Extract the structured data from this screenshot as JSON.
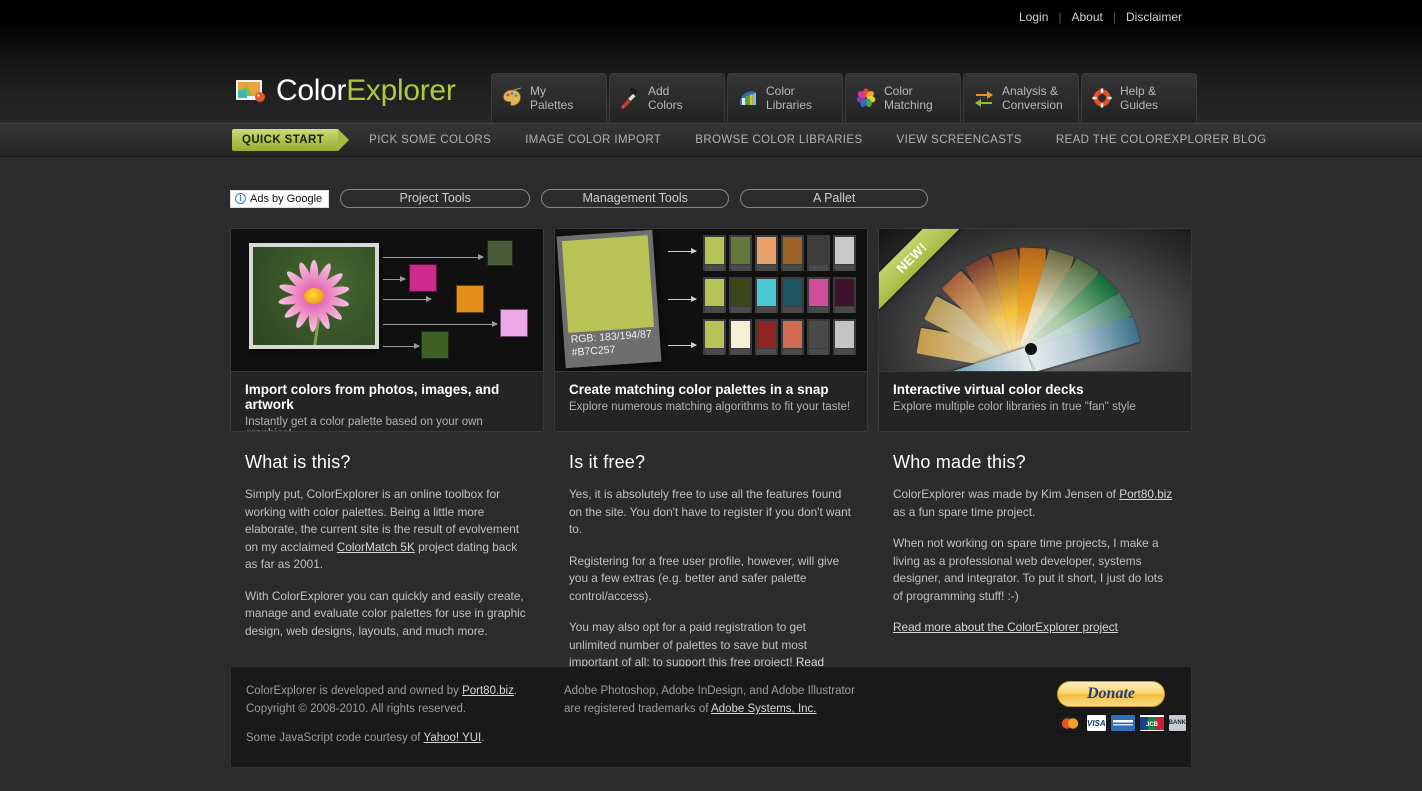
{
  "brand": {
    "name_part1": "Color",
    "name_part2": "Explorer",
    "logo_icon": "picture-palette-icon"
  },
  "utility_nav": [
    {
      "label": "Login"
    },
    {
      "label": "About"
    },
    {
      "label": "Disclaimer"
    }
  ],
  "main_nav": [
    {
      "line1": "My",
      "line2": "Palettes",
      "icon": "palette-icon"
    },
    {
      "line1": "Add",
      "line2": "Colors",
      "icon": "eyedropper-icon"
    },
    {
      "line1": "Color",
      "line2": "Libraries",
      "icon": "color-fan-icon"
    },
    {
      "line1": "Color",
      "line2": "Matching",
      "icon": "color-wheel-flower-icon"
    },
    {
      "line1": "Analysis &",
      "line2": "Conversion",
      "icon": "convert-arrows-icon"
    },
    {
      "line1": "Help &",
      "line2": "Guides",
      "icon": "life-ring-icon"
    }
  ],
  "sub_nav": [
    {
      "label": "QUICK START",
      "active": true
    },
    {
      "label": "PICK SOME COLORS",
      "active": false
    },
    {
      "label": "IMAGE COLOR IMPORT",
      "active": false
    },
    {
      "label": "BROWSE COLOR LIBRARIES",
      "active": false
    },
    {
      "label": "VIEW SCREENCASTS",
      "active": false
    },
    {
      "label": "READ THE COLOREXPLORER BLOG",
      "active": false
    }
  ],
  "ads": {
    "badge_label": "Ads by Google",
    "badge_icon": "info-circle-icon",
    "links": [
      {
        "label": "Project Tools"
      },
      {
        "label": "Management Tools"
      },
      {
        "label": "A Pallet"
      }
    ]
  },
  "cards": [
    {
      "title": "Import colors from photos, images, and artwork",
      "subtitle": "Instantly get a color palette based on your own graphics!",
      "media": "flower-photo-to-swatches",
      "swatch_colors": [
        "#4a5b38",
        "#cd2a8e",
        "#e2901b",
        "#eda7e6",
        "#3f6024"
      ]
    },
    {
      "title": "Create matching color palettes in a snap",
      "subtitle": "Explore numerous matching algorithms to fit your taste!",
      "media": "polaroid-with-palette-grid",
      "base_color_rgb": "RGB: 183/194/87",
      "base_color_hex": "#B7C257",
      "base_swatch": "#b7c257",
      "palette_rows": [
        [
          "#b5c256",
          "#66773a",
          "#e8a06a",
          "#9c6329",
          "#3c3c3c",
          "#c9c9c9"
        ],
        [
          "#b5c256",
          "#3b4718",
          "#4ac8d4",
          "#1a5560",
          "#cf4f9c",
          "#3d142c"
        ],
        [
          "#b5c256",
          "#f7f1d4",
          "#8d2523",
          "#d06a52",
          "#4a4a4a",
          "#c4c4c4"
        ]
      ]
    },
    {
      "title": "Interactive virtual color decks",
      "subtitle": "Explore multiple color libraries in true \"fan\" style",
      "media": "color-fan-deck-photo",
      "ribbon_label": "NEW!"
    }
  ],
  "columns": [
    {
      "heading": "What is this?",
      "paragraphs": [
        {
          "before": "Simply put, ColorExplorer is an online toolbox for working with color palettes. Being a little more elaborate, the current site is the result of evolvement on my acclaimed ",
          "link": "ColorMatch 5K",
          "after": " project dating back as far as 2001."
        },
        {
          "before": "With ColorExplorer you can quickly and easily create, manage and evaluate color palettes for use in graphic design, web designs, layouts, and much more.",
          "link": "",
          "after": ""
        }
      ]
    },
    {
      "heading": "Is it free?",
      "paragraphs": [
        {
          "before": "Yes, it is absolutely free to use all the features found on the site. You don't have to register if you don't want to.",
          "link": "",
          "after": ""
        },
        {
          "before": "Registering for a free user profile, however, will give you a few extras (e.g. better and safer palette control/access).",
          "link": "",
          "after": ""
        },
        {
          "before": "You may also opt for a paid registration to get unlimited number of palettes to save but most important of all; to support this free project! ",
          "link": "Read more ...",
          "after": ""
        }
      ]
    },
    {
      "heading": "Who made this?",
      "paragraphs": [
        {
          "before": "ColorExplorer was made by Kim Jensen of ",
          "link": "Port80.biz",
          "after": " as a fun spare time project."
        },
        {
          "before": "When not working on spare time projects, I make a living as a professional web developer, systems designer, and integrator. To put it short, I just do lots of programming stuff! :-)",
          "link": "",
          "after": ""
        },
        {
          "before": "",
          "link": "Read more about the ColorExplorer project",
          "after": ""
        }
      ]
    }
  ],
  "footer": {
    "line1_before": "ColorExplorer is developed and owned by ",
    "line1_link": "Port80.biz",
    "line1_after": ".",
    "line2": "Copyright © 2008-2010. All rights reserved.",
    "line3_before": "Some JavaScript code courtesy of ",
    "line3_link": "Yahoo! YUI",
    "line3_after": ".",
    "trademark_before": "Adobe Photoshop, Adobe InDesign, and Adobe Illustrator are registered trademarks of ",
    "trademark_link": "Adobe Systems, Inc.",
    "donate_label": "Donate",
    "payment_cards": [
      {
        "label": "MC",
        "color": "#1b1b1b"
      },
      {
        "label": "VISA",
        "color": "#ffffff"
      },
      {
        "label": "AMEX",
        "color": "#2e6fb5"
      },
      {
        "label": "JCB",
        "color": "#1b3f8f"
      },
      {
        "label": "BANK",
        "color": "#c6ccd2"
      }
    ]
  },
  "theme": {
    "accent_green": "#aac93c",
    "page_bg": "#2b2b2b",
    "card_bg": "#171717"
  }
}
